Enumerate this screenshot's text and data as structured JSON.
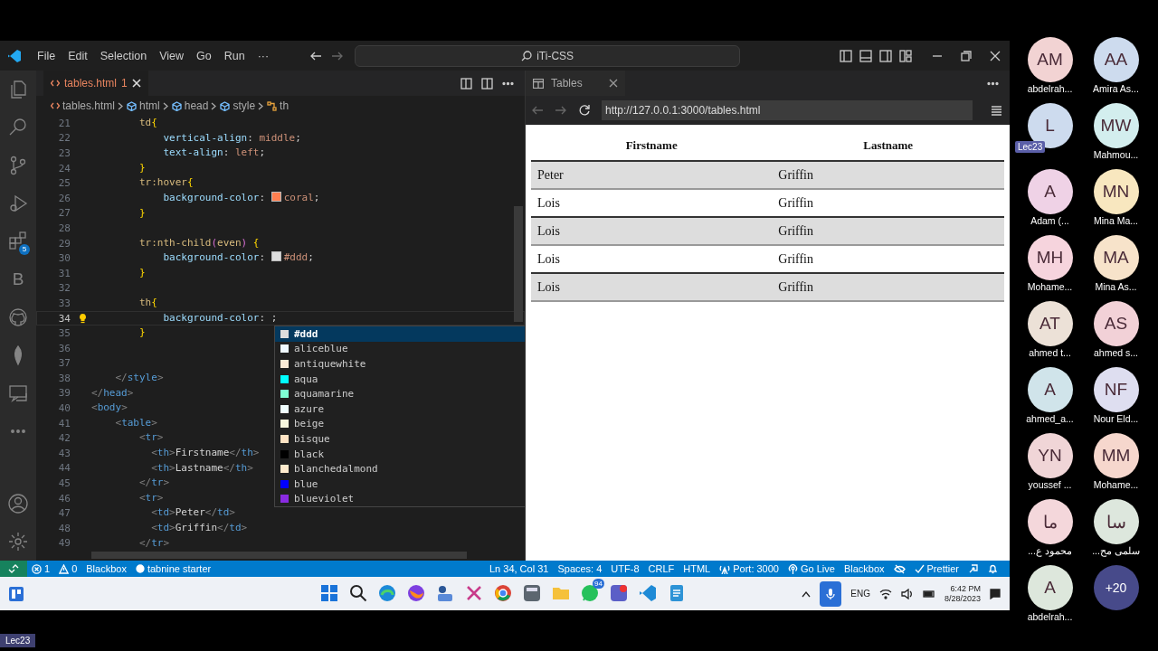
{
  "title_bar": {
    "menu": [
      "File",
      "Edit",
      "Selection",
      "View",
      "Go",
      "Run",
      "···"
    ],
    "search": "iTi-CSS"
  },
  "activity_bar": {
    "extensions_badge": "5",
    "letter": "B"
  },
  "editor": {
    "tab": {
      "label": "tables.html",
      "problems": "1"
    },
    "breadcrumbs": [
      "tables.html",
      "html",
      "head",
      "style",
      "th"
    ],
    "lightbulb": true,
    "lines": [
      {
        "number": "21",
        "current": false,
        "tokens": [
          {
            "kind": "sel",
            "text": "        td"
          },
          {
            "kind": "brace",
            "text": "{"
          }
        ]
      },
      {
        "number": "22",
        "current": false,
        "tokens": [
          {
            "kind": "prop",
            "text": "            vertical-align"
          },
          {
            "kind": "punct",
            "text": ": "
          },
          {
            "kind": "val",
            "text": "middle"
          },
          {
            "kind": "punct",
            "text": ";"
          }
        ]
      },
      {
        "number": "23",
        "current": false,
        "tokens": [
          {
            "kind": "prop",
            "text": "            text-align"
          },
          {
            "kind": "punct",
            "text": ": "
          },
          {
            "kind": "val",
            "text": "left"
          },
          {
            "kind": "punct",
            "text": ";"
          }
        ]
      },
      {
        "number": "24",
        "current": false,
        "tokens": [
          {
            "kind": "brace",
            "text": "        }"
          }
        ]
      },
      {
        "number": "25",
        "current": false,
        "tokens": [
          {
            "kind": "sel",
            "text": "        tr:hover"
          },
          {
            "kind": "brace",
            "text": "{"
          }
        ]
      },
      {
        "number": "26",
        "current": false,
        "tokens": [
          {
            "kind": "prop",
            "text": "            background-color"
          },
          {
            "kind": "punct",
            "text": ": "
          },
          {
            "kind": "swatch",
            "color": "#ff7f50"
          },
          {
            "kind": "val",
            "text": "coral"
          },
          {
            "kind": "punct",
            "text": ";"
          }
        ]
      },
      {
        "number": "27",
        "current": false,
        "tokens": [
          {
            "kind": "brace",
            "text": "        }"
          }
        ]
      },
      {
        "number": "28",
        "current": false
      },
      {
        "number": "29",
        "current": false,
        "tokens": [
          {
            "kind": "sel",
            "text": "        tr:nth-child"
          },
          {
            "kind": "paren",
            "text": "("
          },
          {
            "kind": "sel",
            "text": "even"
          },
          {
            "kind": "paren",
            "text": ")"
          },
          {
            "kind": "brace",
            "text": " {"
          }
        ]
      },
      {
        "number": "30",
        "current": false,
        "tokens": [
          {
            "kind": "prop",
            "text": "            background-color"
          },
          {
            "kind": "punct",
            "text": ": "
          },
          {
            "kind": "swatch",
            "color": "#dddddd"
          },
          {
            "kind": "val",
            "text": "#ddd"
          },
          {
            "kind": "punct",
            "text": ";"
          }
        ]
      },
      {
        "number": "31",
        "current": false,
        "tokens": [
          {
            "kind": "brace",
            "text": "        }"
          }
        ]
      },
      {
        "number": "32",
        "current": false
      },
      {
        "number": "33",
        "current": false,
        "tokens": [
          {
            "kind": "sel",
            "text": "        th"
          },
          {
            "kind": "brace",
            "text": "{"
          }
        ]
      },
      {
        "number": "34",
        "current": true,
        "tokens": [
          {
            "kind": "prop",
            "text": "            background-color"
          },
          {
            "kind": "punct",
            "text": ": "
          },
          {
            "kind": "punct",
            "text": ";"
          }
        ]
      },
      {
        "number": "35",
        "current": false,
        "tokens": [
          {
            "kind": "brace",
            "text": "        }"
          }
        ]
      },
      {
        "number": "36",
        "current": false
      },
      {
        "number": "37",
        "current": false
      },
      {
        "number": "38",
        "current": false,
        "tokens": [
          {
            "kind": "angle",
            "text": "    </"
          },
          {
            "kind": "tag",
            "text": "style"
          },
          {
            "kind": "angle",
            "text": ">"
          }
        ]
      },
      {
        "number": "39",
        "current": false,
        "tokens": [
          {
            "kind": "angle",
            "text": "</"
          },
          {
            "kind": "tag",
            "text": "head"
          },
          {
            "kind": "angle",
            "text": ">"
          }
        ]
      },
      {
        "number": "40",
        "current": false,
        "tokens": [
          {
            "kind": "angle",
            "text": "<"
          },
          {
            "kind": "tag",
            "text": "body"
          },
          {
            "kind": "angle",
            "text": ">"
          }
        ]
      },
      {
        "number": "41",
        "current": false,
        "tokens": [
          {
            "kind": "angle",
            "text": "    <"
          },
          {
            "kind": "tag",
            "text": "table"
          },
          {
            "kind": "angle",
            "text": ">"
          }
        ]
      },
      {
        "number": "42",
        "current": false,
        "tokens": [
          {
            "kind": "angle",
            "text": "        <"
          },
          {
            "kind": "tag",
            "text": "tr"
          },
          {
            "kind": "angle",
            "text": ">"
          }
        ]
      },
      {
        "number": "43",
        "current": false,
        "tokens": [
          {
            "kind": "angle",
            "text": "          <"
          },
          {
            "kind": "tag",
            "text": "th"
          },
          {
            "kind": "angle",
            "text": ">"
          },
          {
            "kind": "text",
            "text": "Firstname"
          },
          {
            "kind": "angle",
            "text": "</"
          },
          {
            "kind": "tag",
            "text": "th"
          },
          {
            "kind": "angle",
            "text": ">"
          }
        ]
      },
      {
        "number": "44",
        "current": false,
        "tokens": [
          {
            "kind": "angle",
            "text": "          <"
          },
          {
            "kind": "tag",
            "text": "th"
          },
          {
            "kind": "angle",
            "text": ">"
          },
          {
            "kind": "text",
            "text": "Lastname"
          },
          {
            "kind": "angle",
            "text": "</"
          },
          {
            "kind": "tag",
            "text": "th"
          },
          {
            "kind": "angle",
            "text": ">"
          }
        ]
      },
      {
        "number": "45",
        "current": false,
        "tokens": [
          {
            "kind": "angle",
            "text": "        </"
          },
          {
            "kind": "tag",
            "text": "tr"
          },
          {
            "kind": "angle",
            "text": ">"
          }
        ]
      },
      {
        "number": "46",
        "current": false,
        "tokens": [
          {
            "kind": "angle",
            "text": "        <"
          },
          {
            "kind": "tag",
            "text": "tr"
          },
          {
            "kind": "angle",
            "text": ">"
          }
        ]
      },
      {
        "number": "47",
        "current": false,
        "tokens": [
          {
            "kind": "angle",
            "text": "          <"
          },
          {
            "kind": "tag",
            "text": "td"
          },
          {
            "kind": "angle",
            "text": ">"
          },
          {
            "kind": "text",
            "text": "Peter"
          },
          {
            "kind": "angle",
            "text": "</"
          },
          {
            "kind": "tag",
            "text": "td"
          },
          {
            "kind": "angle",
            "text": ">"
          }
        ]
      },
      {
        "number": "48",
        "current": false,
        "tokens": [
          {
            "kind": "angle",
            "text": "          <"
          },
          {
            "kind": "tag",
            "text": "td"
          },
          {
            "kind": "angle",
            "text": ">"
          },
          {
            "kind": "text",
            "text": "Griffin"
          },
          {
            "kind": "angle",
            "text": "</"
          },
          {
            "kind": "tag",
            "text": "td"
          },
          {
            "kind": "angle",
            "text": ">"
          }
        ]
      },
      {
        "number": "49",
        "current": false,
        "tokens": [
          {
            "kind": "angle",
            "text": "        </"
          },
          {
            "kind": "tag",
            "text": "tr"
          },
          {
            "kind": "angle",
            "text": ">"
          }
        ]
      }
    ],
    "suggestions": [
      {
        "label": "#ddd",
        "color": "#dddddd",
        "selected": true
      },
      {
        "label": "aliceblue",
        "color": "#f0f8ff",
        "selected": false
      },
      {
        "label": "antiquewhite",
        "color": "#faebd7",
        "selected": false
      },
      {
        "label": "aqua",
        "color": "#00ffff",
        "selected": false
      },
      {
        "label": "aquamarine",
        "color": "#7fffd4",
        "selected": false
      },
      {
        "label": "azure",
        "color": "#f0ffff",
        "selected": false
      },
      {
        "label": "beige",
        "color": "#f5f5dc",
        "selected": false
      },
      {
        "label": "bisque",
        "color": "#ffe4c4",
        "selected": false
      },
      {
        "label": "black",
        "color": "#000000",
        "selected": false
      },
      {
        "label": "blanchedalmond",
        "color": "#ffebcd",
        "selected": false
      },
      {
        "label": "blue",
        "color": "#0000ff",
        "selected": false
      },
      {
        "label": "blueviolet",
        "color": "#8a2be2",
        "selected": false
      }
    ]
  },
  "browser": {
    "tab": "Tables",
    "url": "http://127.0.0.1:3000/tables.html",
    "columns": [
      "Firstname",
      "Lastname"
    ],
    "rows": [
      {
        "cells": [
          "Peter",
          "Griffin"
        ],
        "shaded": true
      },
      {
        "cells": [
          "Lois",
          "Griffin"
        ],
        "shaded": false
      },
      {
        "cells": [
          "Lois",
          "Griffin"
        ],
        "shaded": true
      },
      {
        "cells": [
          "Lois",
          "Griffin"
        ],
        "shaded": false
      },
      {
        "cells": [
          "Lois",
          "Griffin"
        ],
        "shaded": true
      }
    ]
  },
  "status_bar": {
    "left": [
      {
        "kind": "error",
        "text": "1"
      },
      {
        "kind": "warning",
        "text": "0"
      },
      {
        "kind": "plain",
        "text": "Blackbox"
      },
      {
        "kind": "tabnine",
        "text": "tabnine starter"
      }
    ],
    "right": [
      {
        "kind": "plain",
        "text": "Ln 34, Col 31"
      },
      {
        "kind": "plain",
        "text": "Spaces: 4"
      },
      {
        "kind": "plain",
        "text": "UTF-8"
      },
      {
        "kind": "plain",
        "text": "CRLF"
      },
      {
        "kind": "plain",
        "text": "HTML"
      },
      {
        "kind": "port",
        "text": "Port: 3000"
      },
      {
        "kind": "live",
        "text": "Go Live"
      },
      {
        "kind": "plain",
        "text": "Blackbox"
      },
      {
        "kind": "hidden"
      },
      {
        "kind": "formatter",
        "text": "Prettier"
      },
      {
        "kind": "feedback"
      },
      {
        "kind": "notifications"
      }
    ]
  },
  "taskbar": {
    "chat_badge": "94",
    "language": "ENG",
    "time": "6:42 PM",
    "date": "8/28/2023"
  },
  "participants": [
    {
      "initials": "AM",
      "name": "abdelrah...",
      "color": "#f2d3d3"
    },
    {
      "initials": "AA",
      "name": "Amira As...",
      "color": "#cddbee"
    },
    {
      "initials": "L",
      "tag": "Lec23",
      "color": "#cddbee"
    },
    {
      "initials": "MW",
      "name": "Mahmou...",
      "color": "#d3eeee"
    },
    {
      "initials": "A",
      "name": "Adam  (...",
      "color": "#efd2e6"
    },
    {
      "initials": "MN",
      "name": "Mina Ma...",
      "color": "#f8e7bf"
    },
    {
      "initials": "MH",
      "name": "Mohame...",
      "color": "#f6d4dd"
    },
    {
      "initials": "MA",
      "name": "Mina As...",
      "color": "#f7e3ca"
    },
    {
      "initials": "AT",
      "name": "ahmed t...",
      "color": "#ece1d7"
    },
    {
      "initials": "AS",
      "name": "ahmed s...",
      "color": "#f2d1d7"
    },
    {
      "initials": "A",
      "name": "ahmed_a...",
      "color": "#d0e4ea"
    },
    {
      "initials": "NF",
      "name": "Nour Eld...",
      "color": "#dedef0"
    },
    {
      "initials": "YN",
      "name": "youssef ...",
      "color": "#f0d5d7"
    },
    {
      "initials": "MM",
      "name": "Mohame...",
      "color": "#f6d7cd"
    },
    {
      "initials": "ما",
      "name": "محمود ع...",
      "color": "#f4d7db"
    },
    {
      "initials": "سا",
      "name": "سلمى مح...",
      "color": "#dde7dd"
    },
    {
      "initials": "A",
      "name": "abdelrah...",
      "color": "#dde7dc"
    },
    {
      "initials": "+20",
      "color": "#474a8a"
    }
  ],
  "presenter_label": "Lec23"
}
